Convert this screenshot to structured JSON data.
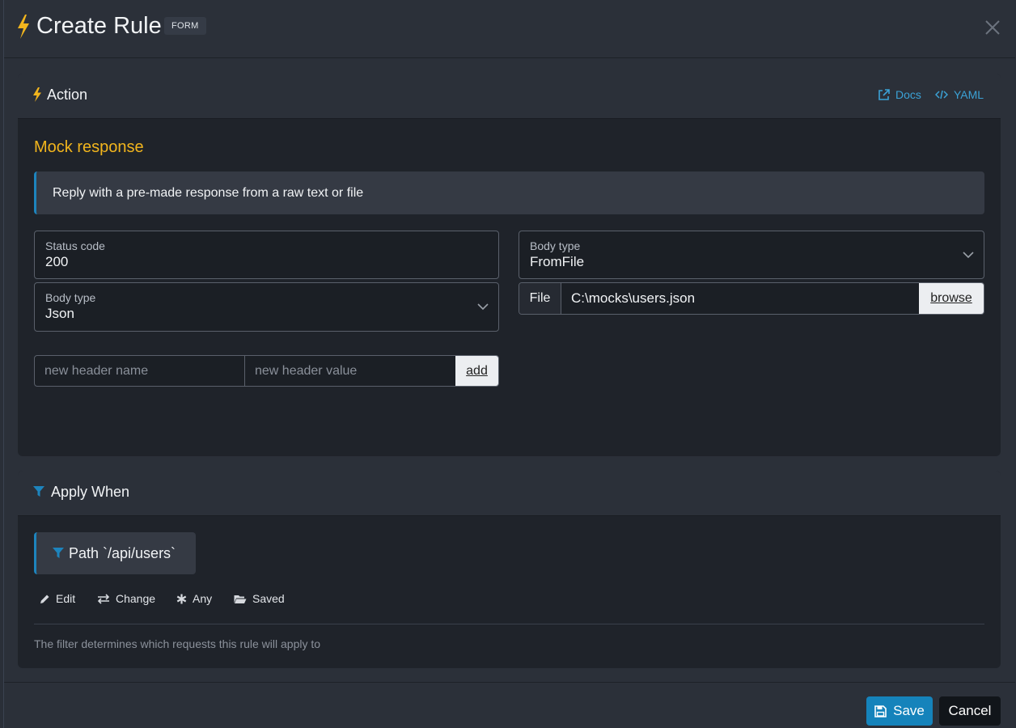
{
  "header": {
    "title": "Create Rule",
    "badge": "FORM"
  },
  "action": {
    "title": "Action",
    "docs_label": "Docs",
    "yaml_label": "YAML",
    "section_title": "Mock response",
    "info": "Reply with a pre-made response from a raw text or file",
    "status_code": {
      "label": "Status code",
      "value": "200"
    },
    "body_type_left": {
      "label": "Body type",
      "value": "Json"
    },
    "body_type_right": {
      "label": "Body type",
      "value": "FromFile"
    },
    "file": {
      "label": "File",
      "value": "C:\\mocks\\users.json",
      "browse_label": "browse"
    },
    "new_header": {
      "name_placeholder": "new header name",
      "value_placeholder": "new header value",
      "add_label": "add"
    }
  },
  "apply_when": {
    "title": "Apply When",
    "filter_chip": "Path `/api/users`",
    "actions": [
      "Edit",
      "Change",
      "Any",
      "Saved"
    ],
    "help": "The filter determines which requests this rule will apply to"
  },
  "footer": {
    "save_label": "Save",
    "cancel_label": "Cancel"
  },
  "colors": {
    "accent": "#f2b51d",
    "primary": "#1583bb",
    "link": "#3ba2d6"
  },
  "icons": [
    "bolt-icon",
    "close-icon",
    "external-link-icon",
    "code-icon",
    "chevron-down-icon",
    "filter-icon",
    "pencil-icon",
    "exchange-icon",
    "asterisk-icon",
    "folder-open-icon",
    "save-icon"
  ]
}
